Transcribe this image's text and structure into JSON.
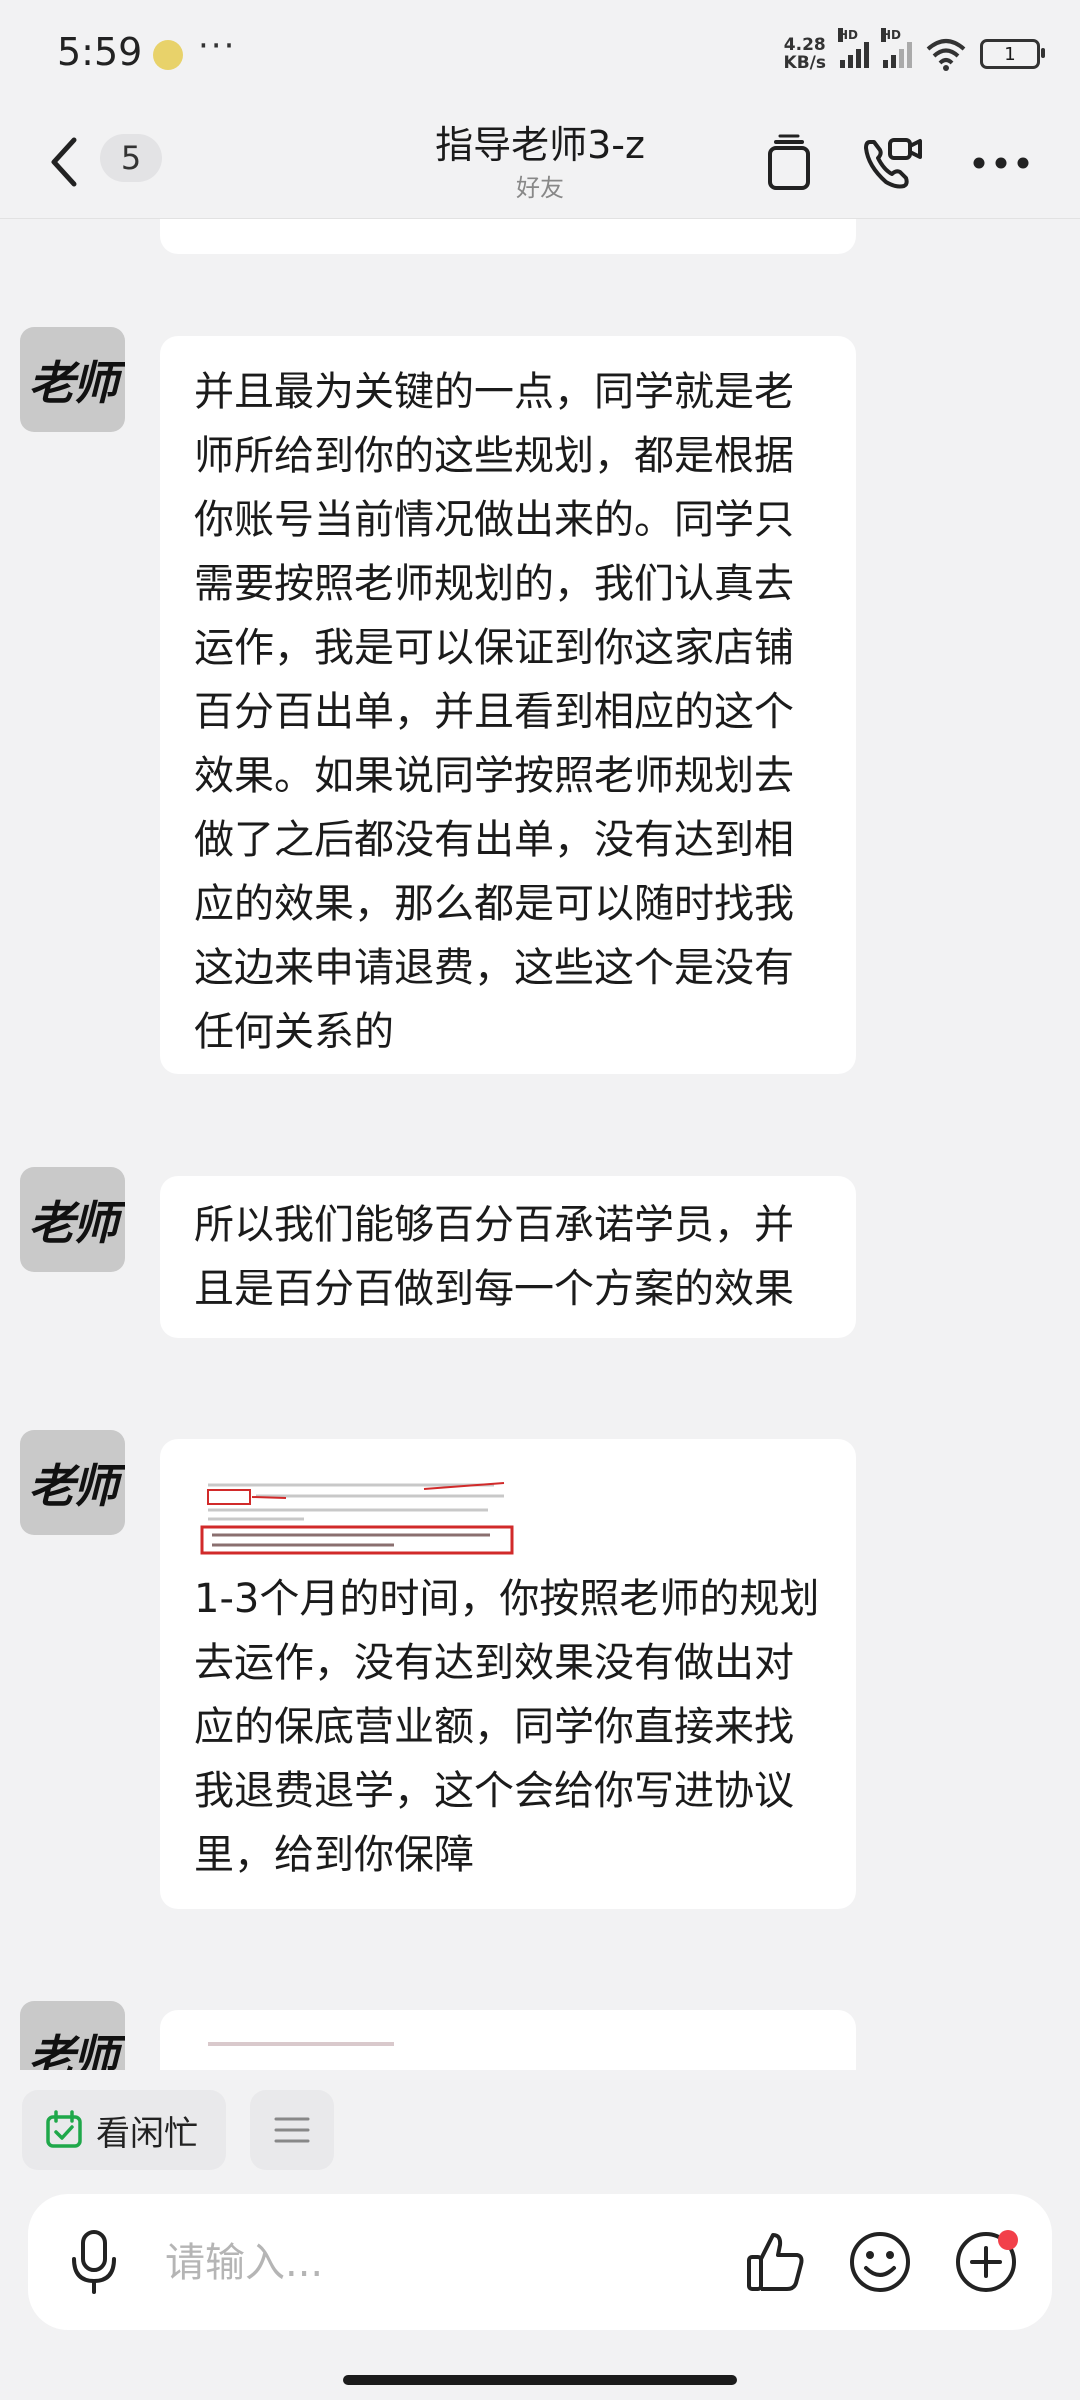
{
  "status_bar": {
    "time": "5:59",
    "more": "···",
    "net_speed_value": "4.28",
    "net_speed_unit": "KB/s",
    "hd1": "HD",
    "hd2": "HD",
    "battery": "1",
    "icons": [
      "app-notification-icon",
      "signal-icon",
      "signal-icon",
      "wifi-icon",
      "battery-icon"
    ]
  },
  "header": {
    "unread_count": "5",
    "title": "指导老师3-z",
    "subtitle": "好友",
    "icons": [
      "back-icon",
      "clipboard-icon",
      "video-call-icon",
      "more-icon"
    ]
  },
  "avatar_text": "老师",
  "messages": [
    {
      "type": "text",
      "text": "并且最为关键的一点，同学就是老师所给到你的这些规划，都是根据你账号当前情况做出来的。同学只需要按照老师规划的，我们认真去运作，我是可以保证到你这家店铺百分百出单，并且看到相应的这个效果。如果说同学按照老师规划去做了之后都没有出单，没有达到相应的效果，那么都是可以随时找我这边来申请退费，这些这个是没有任何关系的"
    },
    {
      "type": "text",
      "text": "所以我们能够百分百承诺学员，并且是百分百做到每一个方案的效果"
    },
    {
      "type": "image_text",
      "image": "contract-excerpt-thumbnail",
      "text": "1-3个月的时间，你按照老师的规划去运作，没有达到效果没有做出对应的保底营业额，同学你直接来找我退费退学，这个会给你写进协议里，给到你保障"
    }
  ],
  "quick_bar": {
    "busy_label": "看闲忙",
    "icons": [
      "calendar-check-icon",
      "menu-icon"
    ]
  },
  "composer": {
    "placeholder": "请输入...",
    "icons": [
      "microphone-icon",
      "thumbs-up-icon",
      "emoji-icon",
      "add-icon"
    ]
  },
  "colors": {
    "background": "#f2f2f3",
    "bubble": "#ffffff",
    "accent_green": "#1fa84a",
    "notification_red": "#f2404a"
  }
}
